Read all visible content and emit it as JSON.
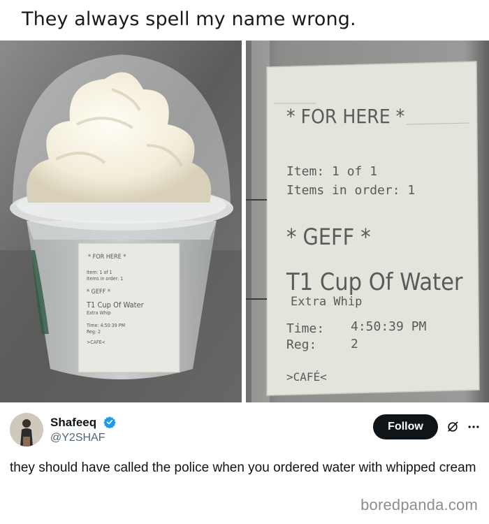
{
  "meme": {
    "caption": "They always spell my name wrong."
  },
  "left_photo": {
    "sticker": {
      "line1": "* FOR HERE *",
      "line2": "Item:   1 of 1",
      "line3": "Items in order: 1",
      "line4": "* GEFF *",
      "line5": "T1 Cup Of Water",
      "line6": "Extra Whip",
      "line7": "Time:  4:50:39 PM",
      "line8": "Reg:   2",
      "line9": ">CAFE<"
    }
  },
  "right_photo": {
    "sticker": {
      "for_here": "* FOR HERE *",
      "item": "Item:   1 of 1",
      "items_in_order": "Items in order: 1",
      "name": "* GEFF *",
      "drink": "T1 Cup Of Water",
      "modifier": "Extra Whip",
      "time_label": "Time:",
      "time_value": "4:50:39 PM",
      "reg_label": "Reg:",
      "reg_value": "2",
      "location": ">CAFÉ<"
    }
  },
  "tweet": {
    "display_name": "Shafeeq",
    "handle": "@Y2SHAF",
    "follow_label": "Follow",
    "text": "they should have called the police when you ordered water with whipped cream",
    "verified_color": "#1d9bf0"
  },
  "watermark": "boredpanda.com"
}
